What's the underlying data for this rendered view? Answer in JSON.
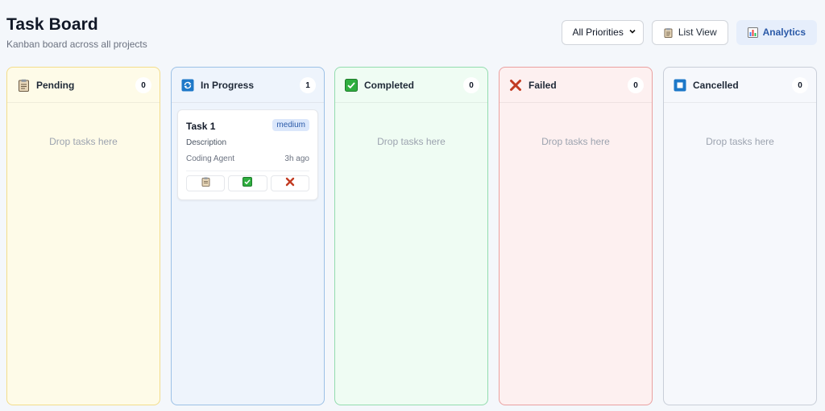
{
  "header": {
    "title": "Task Board",
    "subtitle": "Kanban board across all projects"
  },
  "toolbar": {
    "priority_filter": {
      "selected": "All Priorities"
    },
    "list_view_label": "List View",
    "analytics_label": "Analytics"
  },
  "columns": [
    {
      "name": "Pending",
      "count": "0",
      "icon": "clipboard-icon",
      "empty_text": "Drop tasks here",
      "bg": "#fefbe8",
      "border": "#f3dd8a"
    },
    {
      "name": "In Progress",
      "count": "1",
      "icon": "refresh-icon",
      "empty_text": "",
      "bg": "#eef4fc",
      "border": "#9cc1e6"
    },
    {
      "name": "Completed",
      "count": "0",
      "icon": "check-icon",
      "empty_text": "Drop tasks here",
      "bg": "#effcf3",
      "border": "#93dcae"
    },
    {
      "name": "Failed",
      "count": "0",
      "icon": "cross-icon",
      "empty_text": "Drop tasks here",
      "bg": "#fdf0f0",
      "border": "#eaa0a0"
    },
    {
      "name": "Cancelled",
      "count": "0",
      "icon": "stop-icon",
      "empty_text": "Drop tasks here",
      "bg": "#f6f8fc",
      "border": "#c8ced8"
    }
  ],
  "tasks": [
    {
      "title": "Task 1",
      "priority": "medium",
      "description": "Description",
      "agent": "Coding Agent",
      "time": "3h ago",
      "actions": [
        "move-to-pending",
        "mark-completed",
        "mark-failed"
      ]
    }
  ],
  "colors": {
    "accent": "#2b5aa8",
    "priority_bg": "#dbe7fb"
  }
}
